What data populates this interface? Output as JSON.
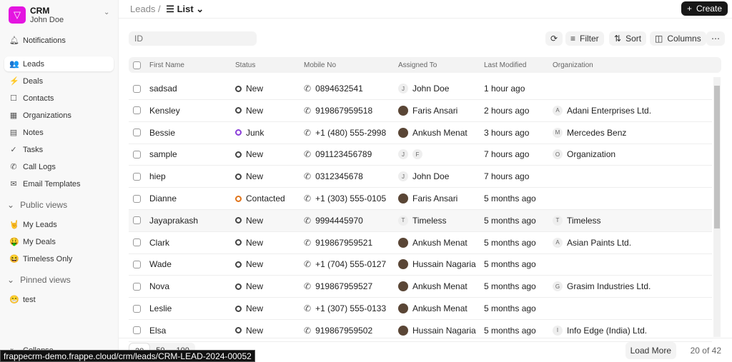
{
  "sidebar": {
    "app": "CRM",
    "user": "John Doe",
    "notifications": "Notifications",
    "items": [
      {
        "label": "Leads",
        "icon": "users-icon",
        "glyph": "👥"
      },
      {
        "label": "Deals",
        "icon": "deals-icon",
        "glyph": "⚡"
      },
      {
        "label": "Contacts",
        "icon": "contacts-icon",
        "glyph": "☐"
      },
      {
        "label": "Organizations",
        "icon": "building-icon",
        "glyph": "▦"
      },
      {
        "label": "Notes",
        "icon": "notes-icon",
        "glyph": "▤"
      },
      {
        "label": "Tasks",
        "icon": "check-icon",
        "glyph": "✓"
      },
      {
        "label": "Call Logs",
        "icon": "phone-icon",
        "glyph": "✆"
      },
      {
        "label": "Email Templates",
        "icon": "mail-icon",
        "glyph": "✉"
      }
    ],
    "public_views_title": "Public views",
    "public_views": [
      {
        "label": "My Leads",
        "emoji": "🤘"
      },
      {
        "label": "My Deals",
        "emoji": "🤑"
      },
      {
        "label": "Timeless Only",
        "emoji": "😆"
      }
    ],
    "pinned_views_title": "Pinned views",
    "pinned_views": [
      {
        "label": "test",
        "emoji": "😁"
      }
    ],
    "collapse": "Collapse"
  },
  "header": {
    "breadcrumb": "Leads /",
    "view": "List",
    "create": "Create"
  },
  "toolbar": {
    "id_placeholder": "ID",
    "filter": "Filter",
    "sort": "Sort",
    "columns": "Columns"
  },
  "columns": [
    "First Name",
    "Status",
    "Mobile No",
    "Assigned To",
    "Last Modified",
    "Organization"
  ],
  "status_colors": {
    "New": "#444444",
    "Junk": "#8b3fd9",
    "Contacted": "#e0741b"
  },
  "rows": [
    {
      "name": "sadsad",
      "status": "New",
      "mobile": "0894632541",
      "assigned": "John Doe",
      "av": "J",
      "modified": "1 hour ago",
      "org": "",
      "oi": ""
    },
    {
      "name": "Kensley",
      "status": "New",
      "mobile": "919867959518",
      "assigned": "Faris Ansari",
      "av": "",
      "modified": "2 hours ago",
      "org": "Adani Enterprises Ltd.",
      "oi": "A"
    },
    {
      "name": "Bessie",
      "status": "Junk",
      "mobile": "+1 (480) 555-2998",
      "assigned": "Ankush Menat",
      "av": "",
      "modified": "3 hours ago",
      "org": "Mercedes Benz",
      "oi": "M"
    },
    {
      "name": "sample",
      "status": "New",
      "mobile": "091123456789",
      "assigned": "",
      "av": "J F",
      "modified": "7 hours ago",
      "org": "Organization",
      "oi": "O"
    },
    {
      "name": "hiep",
      "status": "New",
      "mobile": "0312345678",
      "assigned": "John Doe",
      "av": "J",
      "modified": "7 hours ago",
      "org": "",
      "oi": ""
    },
    {
      "name": "Dianne",
      "status": "Contacted",
      "mobile": "+1 (303) 555-0105",
      "assigned": "Faris Ansari",
      "av": "",
      "modified": "5 months ago",
      "org": "",
      "oi": ""
    },
    {
      "name": "Jayaprakash",
      "status": "New",
      "mobile": "9994445970",
      "assigned": "Timeless",
      "av": "T",
      "modified": "5 months ago",
      "org": "Timeless",
      "oi": "T"
    },
    {
      "name": "Clark",
      "status": "New",
      "mobile": "919867959521",
      "assigned": "Ankush Menat",
      "av": "",
      "modified": "5 months ago",
      "org": "Asian Paints Ltd.",
      "oi": "A"
    },
    {
      "name": "Wade",
      "status": "New",
      "mobile": "+1 (704) 555-0127",
      "assigned": "Hussain Nagaria",
      "av": "",
      "modified": "5 months ago",
      "org": "",
      "oi": ""
    },
    {
      "name": "Nova",
      "status": "New",
      "mobile": "919867959527",
      "assigned": "Ankush Menat",
      "av": "",
      "modified": "5 months ago",
      "org": "Grasim Industries Ltd.",
      "oi": "G"
    },
    {
      "name": "Leslie",
      "status": "New",
      "mobile": "+1 (307) 555-0133",
      "assigned": "Ankush Menat",
      "av": "",
      "modified": "5 months ago",
      "org": "",
      "oi": ""
    },
    {
      "name": "Elsa",
      "status": "New",
      "mobile": "919867959502",
      "assigned": "Hussain Nagaria",
      "av": "",
      "modified": "5 months ago",
      "org": "Info Edge (India) Ltd.",
      "oi": "I"
    }
  ],
  "footer": {
    "page_sizes": [
      "20",
      "50",
      "100"
    ],
    "load_more": "Load More",
    "count": "20 of 42"
  },
  "status_bar": "frappecrm-demo.frappe.cloud/crm/leads/CRM-LEAD-2024-00052"
}
